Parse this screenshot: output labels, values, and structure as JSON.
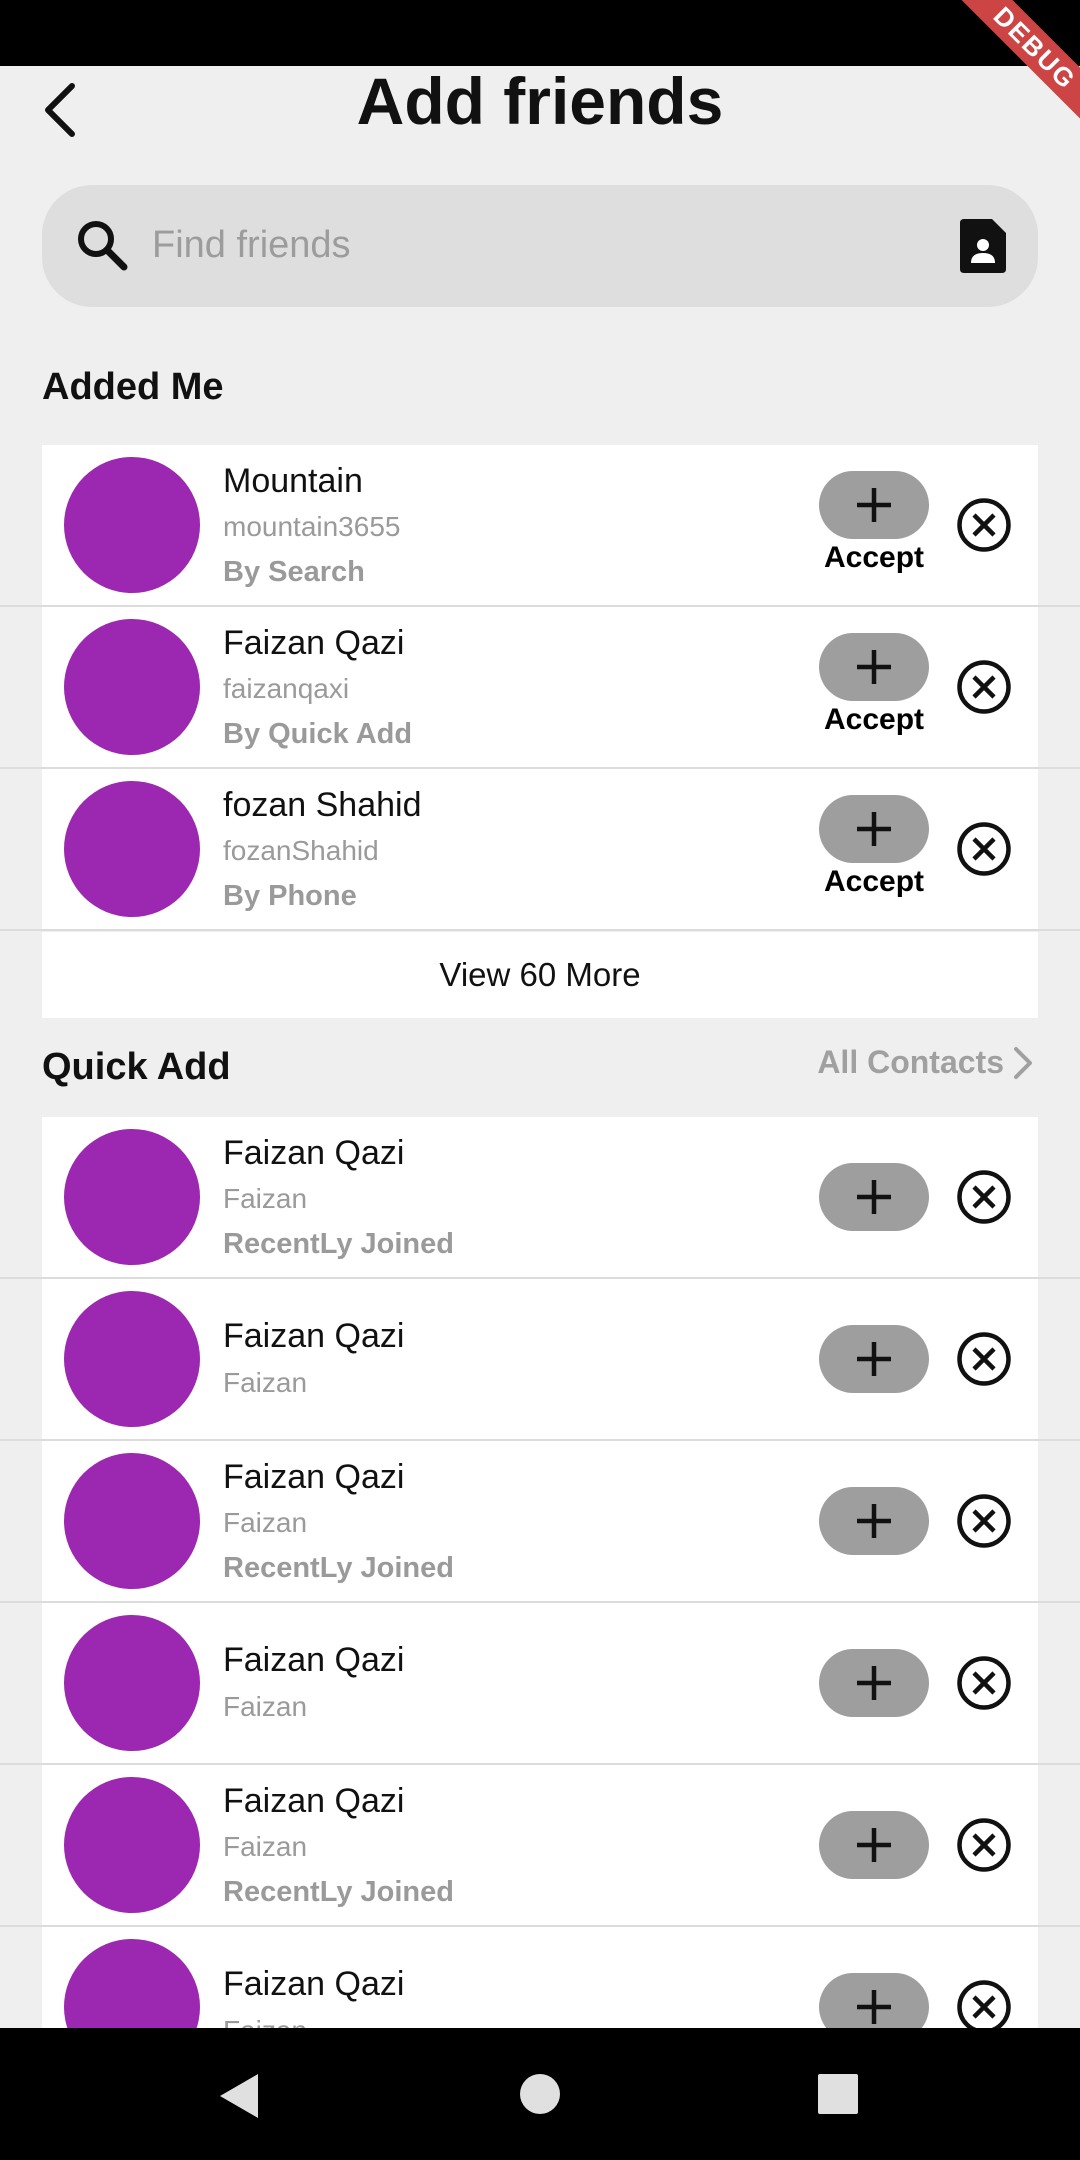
{
  "app": {
    "title": "Add friends",
    "debug_banner": "DEBUG"
  },
  "search": {
    "placeholder": "Find friends",
    "value": ""
  },
  "added_me": {
    "title": "Added Me",
    "accept_label": "Accept",
    "items": [
      {
        "name": "Mountain",
        "username": "mountain3655",
        "source": "By Search"
      },
      {
        "name": "Faizan Qazi",
        "username": "faizanqaxi",
        "source": "By Quick Add"
      },
      {
        "name": "fozan Shahid",
        "username": "fozanShahid",
        "source": "By Phone"
      }
    ],
    "view_more_label": "View 60 More"
  },
  "quick_add": {
    "title": "Quick Add",
    "all_contacts_label": "All Contacts",
    "items": [
      {
        "name": "Faizan Qazi",
        "username": "Faizan",
        "source": "RecentLy Joined"
      },
      {
        "name": "Faizan Qazi",
        "username": "Faizan",
        "source": ""
      },
      {
        "name": "Faizan Qazi",
        "username": "Faizan",
        "source": "RecentLy Joined"
      },
      {
        "name": "Faizan Qazi",
        "username": "Faizan",
        "source": ""
      },
      {
        "name": "Faizan Qazi",
        "username": "Faizan",
        "source": "RecentLy Joined"
      },
      {
        "name": "Faizan Qazi",
        "username": "Faizan",
        "source": ""
      }
    ]
  },
  "colors": {
    "avatar": "#9c27b0",
    "add_button": "#9e9e9e",
    "background": "#efefef"
  },
  "icons": {
    "back": "back-arrow-icon",
    "search": "search-icon",
    "contact": "contact-card-icon",
    "add": "plus-icon",
    "dismiss": "close-circle-icon",
    "chevron": "chevron-right-icon"
  }
}
